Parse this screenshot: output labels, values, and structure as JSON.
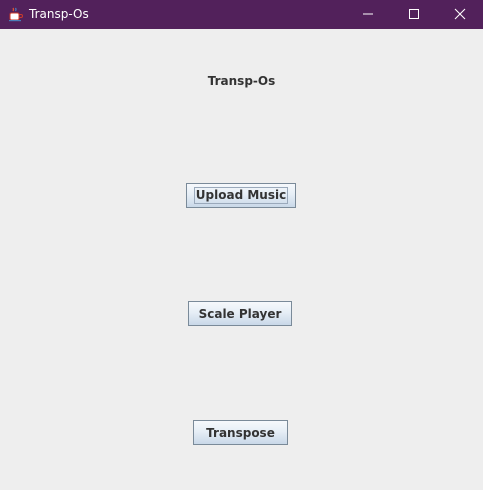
{
  "window": {
    "title": "Transp-Os",
    "titlebar_color": "#52215b",
    "icons": {
      "app": "java-cup-icon",
      "minimize": "minimize-icon",
      "maximize": "maximize-icon",
      "close": "close-icon"
    }
  },
  "main": {
    "heading": "Transp-Os",
    "buttons": {
      "upload": "Upload Music",
      "scale": "Scale Player",
      "transpose": "Transpose"
    }
  },
  "colors": {
    "background": "#eeeeee",
    "button_border": "#7a8a99"
  }
}
